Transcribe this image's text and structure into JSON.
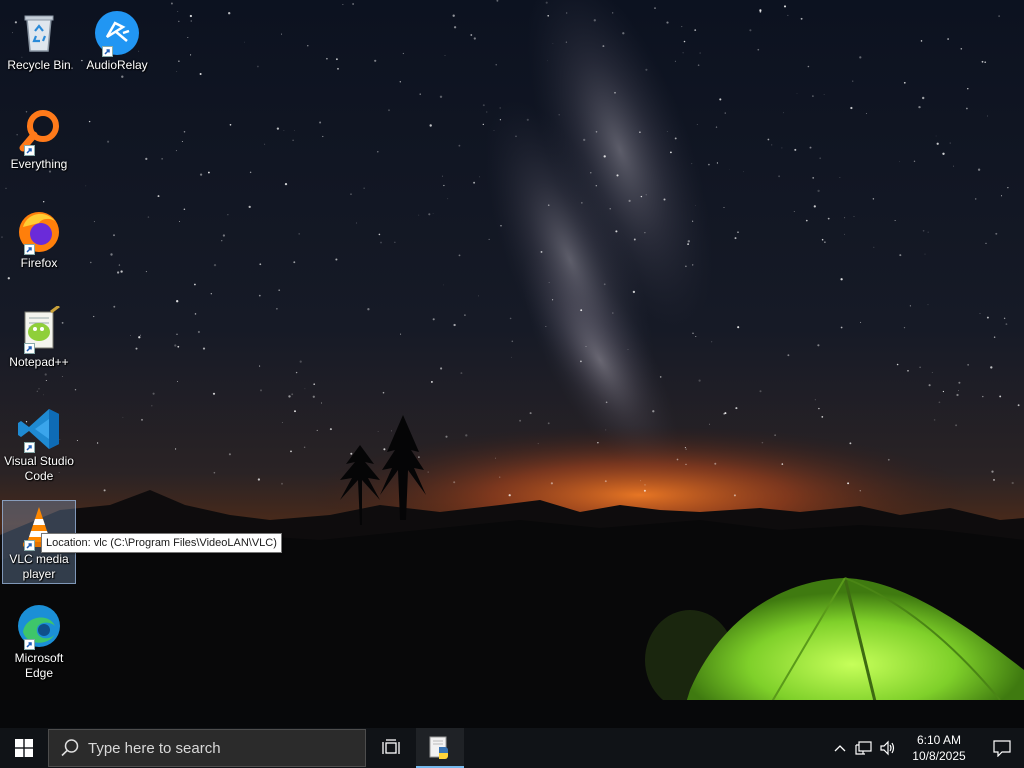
{
  "desktop": {
    "icons": [
      {
        "label": "Recycle Bin",
        "icon": "recycle-bin-icon",
        "shortcut": false
      },
      {
        "label": "AudioRelay",
        "icon": "audiorelay-icon",
        "shortcut": true
      },
      {
        "label": "Everything",
        "icon": "everything-search-icon",
        "shortcut": true
      },
      {
        "label": "Firefox",
        "icon": "firefox-icon",
        "shortcut": true
      },
      {
        "label": "Notepad++",
        "icon": "notepadpp-icon",
        "shortcut": true
      },
      {
        "label": "Visual Studio Code",
        "icon": "vscode-icon",
        "shortcut": true
      },
      {
        "label": "VLC media player",
        "icon": "vlc-icon",
        "shortcut": true,
        "selected": true
      },
      {
        "label": "Microsoft Edge",
        "icon": "edge-icon",
        "shortcut": true
      }
    ],
    "tooltip": "Location: vlc (C:\\Program Files\\VideoLAN\\VLC)"
  },
  "taskbar": {
    "search_placeholder": "Type here to search",
    "pinned": [
      {
        "icon": "task-view-icon"
      },
      {
        "icon": "python-app-icon",
        "active": true
      }
    ],
    "tray_icons": [
      "chevron-up-icon",
      "network-icon",
      "volume-icon"
    ],
    "clock": {
      "time": "6:10 AM",
      "date": "10/8/2025"
    },
    "notification_icon": "action-center-icon"
  },
  "colors": {
    "taskbar": "#101317",
    "tent": "#7fd02a",
    "horizon_glow": "#e0641a",
    "accent": "#76b9ed"
  }
}
